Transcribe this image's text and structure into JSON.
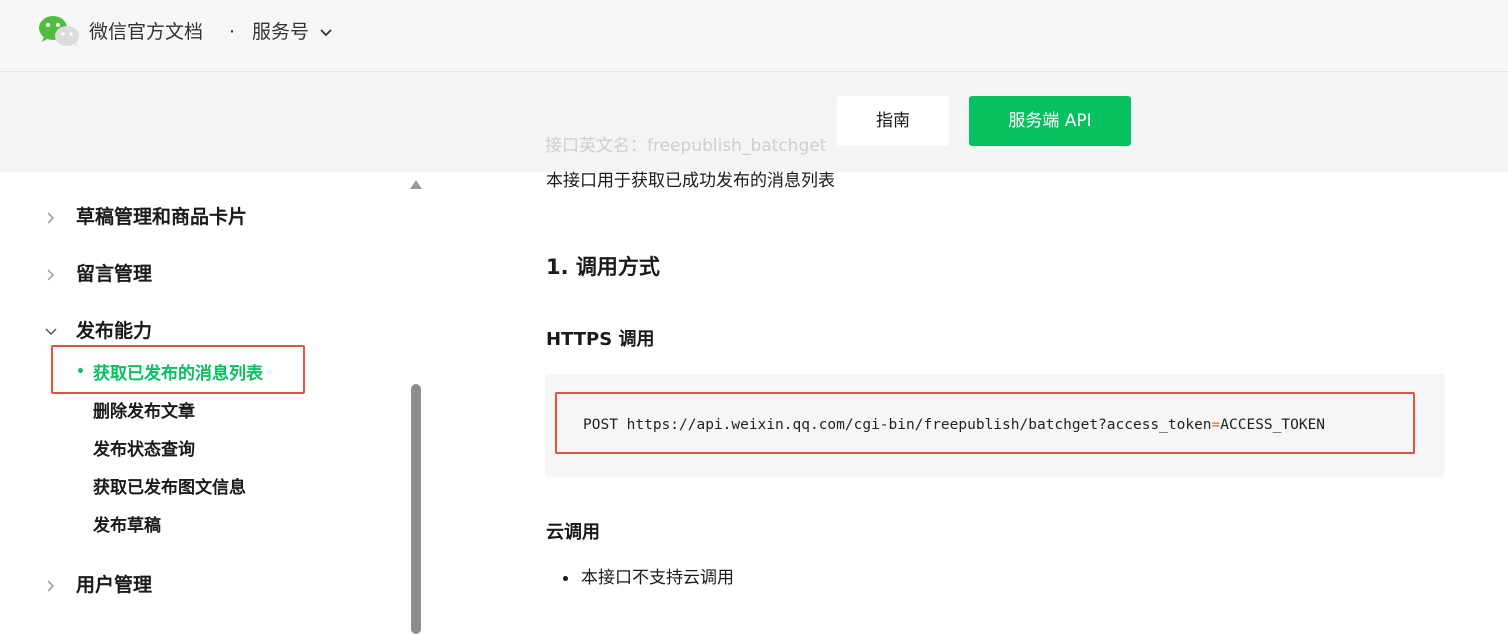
{
  "header": {
    "brand_title": "微信官方文档",
    "separator": "·",
    "product_label": "服务号",
    "logo_icon": "wechat-logo-icon",
    "switch_icon": "chevron-down-icon"
  },
  "tabs": {
    "guide_label": "指南",
    "api_label": "服务端 API",
    "active": "服务端 API"
  },
  "sidebar": {
    "groups": [
      {
        "label": "草稿管理和商品卡片",
        "expanded": false
      },
      {
        "label": "留言管理",
        "expanded": false
      },
      {
        "label": "发布能力",
        "expanded": true
      },
      {
        "label": "用户管理",
        "expanded": false
      }
    ],
    "items": [
      {
        "label": "获取已发布的消息列表",
        "active": true
      },
      {
        "label": "删除发布文章",
        "active": false
      },
      {
        "label": "发布状态查询",
        "active": false
      },
      {
        "label": "获取已发布图文信息",
        "active": false
      },
      {
        "label": "发布草稿",
        "active": false
      }
    ]
  },
  "content": {
    "intro": "本接口用于获取已成功发布的消息列表",
    "section_title": "1. 调用方式",
    "https_heading": "HTTPS 调用",
    "code": {
      "prefix": "POST https://api.weixin.qq.com/cgi-bin/freepublish/batchget?access_token",
      "op": "=",
      "suffix": "ACCESS_TOKEN"
    },
    "cloud_heading": "云调用",
    "cloud_items": [
      "本接口不支持云调用"
    ]
  },
  "colors": {
    "accent": "#07c160",
    "highlight": "#e35247"
  }
}
